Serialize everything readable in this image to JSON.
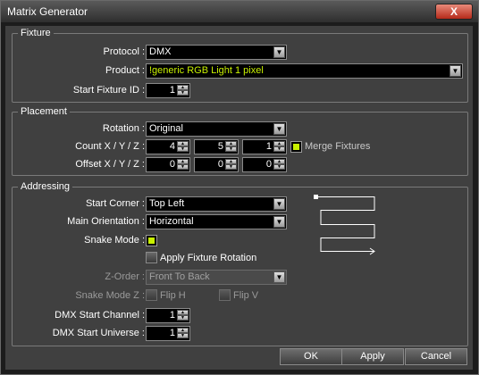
{
  "window": {
    "title": "Matrix Generator",
    "close_label": "X"
  },
  "fixture": {
    "legend": "Fixture",
    "protocol_label": "Protocol :",
    "protocol_value": "DMX",
    "product_label": "Product :",
    "product_value": "!generic RGB Light 1 pixel",
    "start_id_label": "Start Fixture ID :",
    "start_id_value": "1"
  },
  "placement": {
    "legend": "Placement",
    "rotation_label": "Rotation :",
    "rotation_value": "Original",
    "count_label": "Count X / Y / Z :",
    "count_x": "4",
    "count_y": "5",
    "count_z": "1",
    "merge_label": "Merge Fixtures",
    "offset_label": "Offset X / Y / Z :",
    "offset_x": "0",
    "offset_y": "0",
    "offset_z": "0"
  },
  "addressing": {
    "legend": "Addressing",
    "start_corner_label": "Start Corner :",
    "start_corner_value": "Top Left",
    "orientation_label": "Main Orientation :",
    "orientation_value": "Horizontal",
    "snake_label": "Snake Mode :",
    "snake_checked": true,
    "apply_rotation_label": "Apply Fixture Rotation",
    "zorder_label": "Z-Order :",
    "zorder_value": "Front To Back",
    "snake_z_label": "Snake Mode Z :",
    "flip_h_label": "Flip H",
    "flip_v_label": "Flip V",
    "dmx_channel_label": "DMX Start Channel :",
    "dmx_channel_value": "1",
    "dmx_universe_label": "DMX Start Universe :",
    "dmx_universe_value": "1"
  },
  "buttons": {
    "ok": "OK",
    "apply": "Apply",
    "cancel": "Cancel"
  },
  "colors": {
    "accent": "#c8f000",
    "background": "#404040",
    "close": "#c0392b"
  },
  "icons": {
    "close": "close-icon",
    "dropdown": "chevron-down-icon",
    "spin": "spin-arrows-icon"
  }
}
